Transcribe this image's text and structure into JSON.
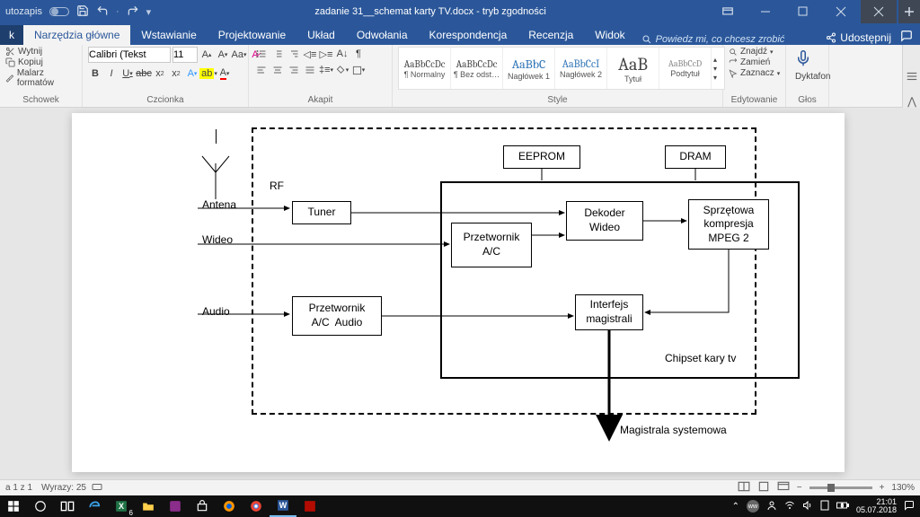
{
  "titlebar": {
    "autosave": "utozapis",
    "filename": "zadanie 31__schemat karty TV.docx  -  tryb zgodności"
  },
  "tabs": {
    "file": "k",
    "home": "Narzędzia główne",
    "insert": "Wstawianie",
    "design": "Projektowanie",
    "layout": "Układ",
    "references": "Odwołania",
    "mailings": "Korespondencja",
    "review": "Recenzja",
    "view": "Widok",
    "tellme": "Powiedz mi, co chcesz zrobić",
    "share": "Udostępnij"
  },
  "ribbon": {
    "clipboard": {
      "cut": "Wytnij",
      "copy": "Kopiuj",
      "painter": "Malarz formatów",
      "label": "Schowek"
    },
    "font": {
      "name": "Calibri (Tekst",
      "size": "11",
      "label": "Czcionka"
    },
    "paragraph": {
      "label": "Akapit"
    },
    "styles": {
      "s1": "¶ Normalny",
      "s2": "¶ Bez odst…",
      "s3": "Nagłówek 1",
      "s4": "Nagłówek 2",
      "s5": "Tytuł",
      "s6": "Podtytuł",
      "preview1": "AaBbCcDc",
      "preview2": "AaBbCcDc",
      "preview3": "AaBbC",
      "preview4": "AaBbCcI",
      "preview5": "AaB",
      "preview6": "AaBbCcD",
      "label": "Style"
    },
    "editing": {
      "find": "Znajdź",
      "replace": "Zamień",
      "select": "Zaznacz",
      "label": "Edytowanie"
    },
    "voice": {
      "dictate": "Dyktafon",
      "label": "Głos"
    }
  },
  "diagram": {
    "eeprom": "EEPROM",
    "dram": "DRAM",
    "rf": "RF",
    "antena": "Antena",
    "tuner": "Tuner",
    "wideo": "Wideo",
    "przetwornikAC": "Przetwornik\nA/C",
    "dekoder": "Dekoder\nWideo",
    "kompresja": "Sprzętowa\nkompresja\nMPEG 2",
    "audio": "Audio",
    "przetwornikAudio": "Przetwornik\nA/C  Audio",
    "interfejs": "Interfejs\nmagistrali",
    "chipset": "Chipset kary tv",
    "magistrala": "Magistrala systemowa"
  },
  "status": {
    "page": "a 1 z 1",
    "words": "Wyrazy: 25",
    "zoom": "130%"
  },
  "tray": {
    "time": "21:01",
    "date": "05.07.2018"
  }
}
